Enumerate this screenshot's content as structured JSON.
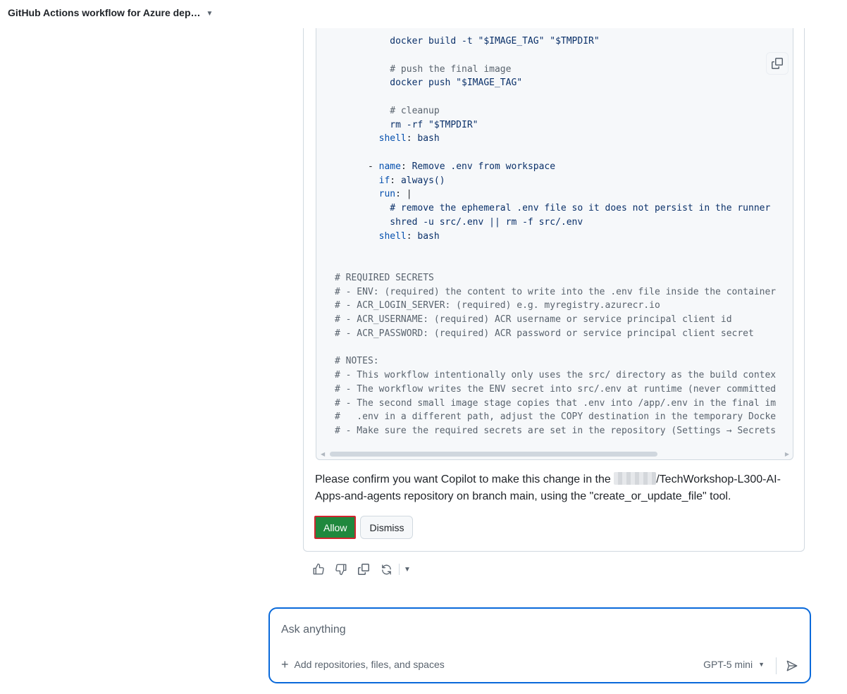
{
  "header": {
    "title": "GitHub Actions workflow for Azure dep…"
  },
  "code": {
    "lines": [
      [
        {
          "t": "          docker build -t \"$IMAGE_TAG\" \"$TMPDIR\"",
          "c": "str"
        }
      ],
      [
        {
          "t": "",
          "c": "plain"
        }
      ],
      [
        {
          "t": "          # push the final image",
          "c": "com"
        }
      ],
      [
        {
          "t": "          docker push \"$IMAGE_TAG\"",
          "c": "str"
        }
      ],
      [
        {
          "t": "",
          "c": "plain"
        }
      ],
      [
        {
          "t": "          # cleanup",
          "c": "com"
        }
      ],
      [
        {
          "t": "          rm -rf \"$TMPDIR\"",
          "c": "str"
        }
      ],
      [
        {
          "t": "        shell",
          "c": "key"
        },
        {
          "t": ": ",
          "c": "punc"
        },
        {
          "t": "bash",
          "c": "str"
        }
      ],
      [
        {
          "t": "",
          "c": "plain"
        }
      ],
      [
        {
          "t": "      - ",
          "c": "punc"
        },
        {
          "t": "name",
          "c": "key"
        },
        {
          "t": ": ",
          "c": "punc"
        },
        {
          "t": "Remove .env from workspace",
          "c": "str"
        }
      ],
      [
        {
          "t": "        if",
          "c": "key"
        },
        {
          "t": ": ",
          "c": "punc"
        },
        {
          "t": "always()",
          "c": "str"
        }
      ],
      [
        {
          "t": "        run",
          "c": "key"
        },
        {
          "t": ": ",
          "c": "punc"
        },
        {
          "t": "|",
          "c": "punc"
        }
      ],
      [
        {
          "t": "          # remove the ephemeral .env file so it does not persist in the runner",
          "c": "str"
        }
      ],
      [
        {
          "t": "          shred -u src/.env || rm -f src/.env",
          "c": "str"
        }
      ],
      [
        {
          "t": "        shell",
          "c": "key"
        },
        {
          "t": ": ",
          "c": "punc"
        },
        {
          "t": "bash",
          "c": "str"
        }
      ],
      [
        {
          "t": "",
          "c": "plain"
        }
      ],
      [
        {
          "t": "",
          "c": "plain"
        }
      ],
      [
        {
          "t": "# REQUIRED SECRETS",
          "c": "com"
        }
      ],
      [
        {
          "t": "# - ENV: (required) the content to write into the .env file inside the container",
          "c": "com"
        }
      ],
      [
        {
          "t": "# - ACR_LOGIN_SERVER: (required) e.g. myregistry.azurecr.io",
          "c": "com"
        }
      ],
      [
        {
          "t": "# - ACR_USERNAME: (required) ACR username or service principal client id",
          "c": "com"
        }
      ],
      [
        {
          "t": "# - ACR_PASSWORD: (required) ACR password or service principal client secret",
          "c": "com"
        }
      ],
      [
        {
          "t": "",
          "c": "plain"
        }
      ],
      [
        {
          "t": "# NOTES:",
          "c": "com"
        }
      ],
      [
        {
          "t": "# - This workflow intentionally only uses the src/ directory as the build contex",
          "c": "com"
        }
      ],
      [
        {
          "t": "# - The workflow writes the ENV secret into src/.env at runtime (never committed",
          "c": "com"
        }
      ],
      [
        {
          "t": "# - The second small image stage copies that .env into /app/.env in the final im",
          "c": "com"
        }
      ],
      [
        {
          "t": "#   .env in a different path, adjust the COPY destination in the temporary Docke",
          "c": "com"
        }
      ],
      [
        {
          "t": "# - Make sure the required secrets are set in the repository (Settings → Secrets",
          "c": "com"
        }
      ]
    ]
  },
  "confirm": {
    "before": "Please confirm you want Copilot to make this change in the ",
    "after": "/TechWorkshop-L300-AI-Apps-and-agents repository on branch main, using the \"create_or_update_file\" tool."
  },
  "buttons": {
    "allow": "Allow",
    "dismiss": "Dismiss"
  },
  "composer": {
    "placeholder": "Ask anything",
    "add_label": "Add repositories, files, and spaces",
    "model": "GPT-5 mini"
  },
  "colors": {
    "accent": "#0969da",
    "allow_green": "#1f883d",
    "highlight_red": "#d1242f"
  },
  "icons": {
    "copy": "copy-icon",
    "thumbs_up": "thumbs-up-icon",
    "thumbs_down": "thumbs-down-icon",
    "retry": "retry-icon",
    "send": "send-icon",
    "plus": "plus-icon"
  }
}
